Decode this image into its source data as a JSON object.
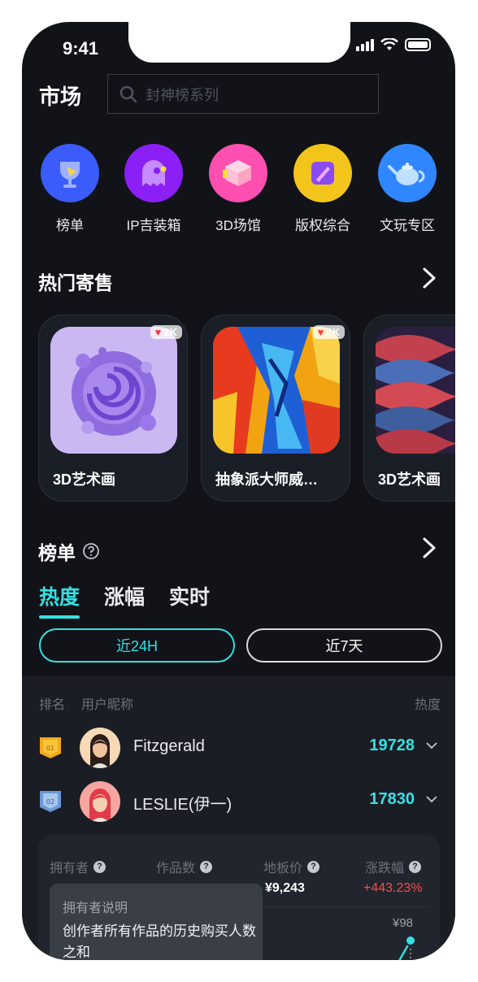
{
  "status_bar": {
    "time": "9:41"
  },
  "header": {
    "title": "市场",
    "search_placeholder": "封神榜系列"
  },
  "categories": [
    {
      "label": "榜单",
      "icon": "trophy-icon",
      "color": "#3b5bfa"
    },
    {
      "label": "IP吉装箱",
      "icon": "ghost-icon",
      "color": "#8b1ff5"
    },
    {
      "label": "3D场馆",
      "icon": "cube-icon",
      "color": "#ff4fb0"
    },
    {
      "label": "版权综合",
      "icon": "pen-icon",
      "color": "#f3c51a"
    },
    {
      "label": "文玩专区",
      "icon": "teapot-icon",
      "color": "#2f86ff"
    }
  ],
  "hot_consign": {
    "title": "热门寄售",
    "cards": [
      {
        "title": "3D艺术画",
        "likes": "2K"
      },
      {
        "title": "抽象派大师威…",
        "likes": "2K"
      },
      {
        "title": "3D艺术画"
      }
    ]
  },
  "leaderboard": {
    "title": "榜单",
    "tabs": [
      "热度",
      "涨幅",
      "实时"
    ],
    "active_tab": "热度",
    "ranges": [
      "近24H",
      "近7天"
    ],
    "active_range": "近24H",
    "columns": {
      "rank": "排名",
      "nickname": "用户昵称",
      "heat": "热度"
    },
    "rows": [
      {
        "rank": "01",
        "name": "Fitzgerald",
        "score": "19728"
      },
      {
        "rank": "02",
        "name": "LESLIE(伊一)",
        "score": "17830"
      }
    ],
    "details": {
      "headers": [
        "拥有者",
        "作品数",
        "地板价",
        "涨跌幅"
      ],
      "floor_price": "¥9,243",
      "change": "+443.23%",
      "price_point": "¥98"
    },
    "tooltip": {
      "title": "拥有者说明",
      "body": "创作者所有作品的历史购买人数之和"
    }
  },
  "colors": {
    "accent": "#35e0e3",
    "negative": "#ff4a4a",
    "background": "#111318"
  }
}
